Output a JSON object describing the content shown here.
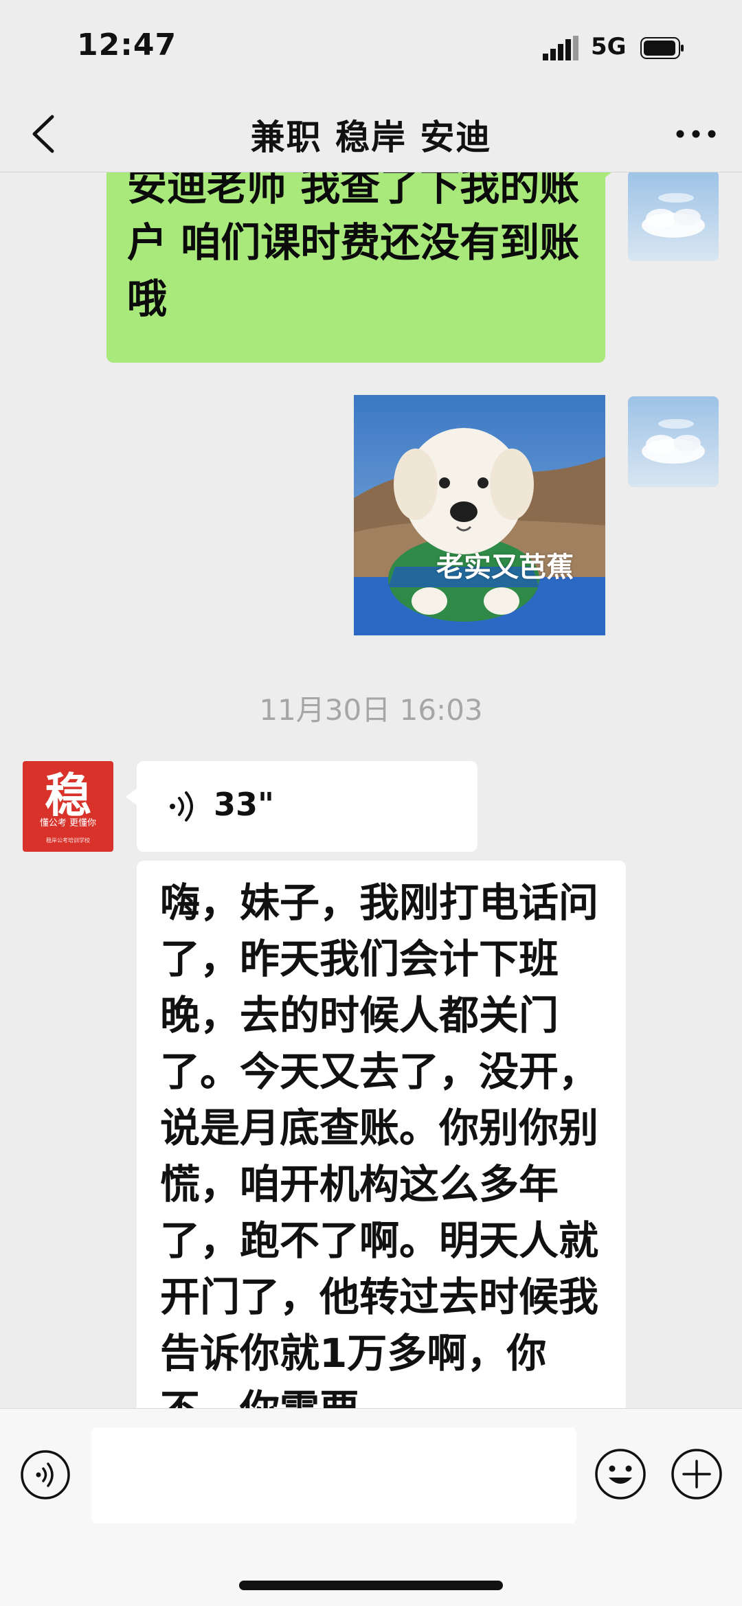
{
  "status_bar": {
    "time": "12:47",
    "network": "5G"
  },
  "nav": {
    "title": "兼职 稳岸 安迪"
  },
  "messages": {
    "outgoing_text": "安迪老师 我查了下我的账户 咱们课时费还没有到账哦",
    "sticker_caption": "老实又芭蕉",
    "timestamp": "11月30日 16:03",
    "voice_duration": "33\"",
    "incoming_text": "嗨，妹子，我刚打电话问了，昨天我们会计下班晚，去的时候人都关门了。今天又去了，没开，说是月底查账。你别你别慌，咱开机构这么多年了，跑不了啊。明天人就开门了，他转过去时候我告诉你就1万多啊，你不，你需要"
  },
  "avatar_other": {
    "logo_char": "稳",
    "slogan": "懂公考 更懂你",
    "small_text": "稳岸公考培训学校",
    "color": "#d8322a"
  },
  "colors": {
    "outgoing_bubble": "#a9e97b",
    "incoming_bubble": "#ffffff",
    "background": "#ededed"
  },
  "icons": {
    "back": "chevron-left-icon",
    "more": "more-dots-icon",
    "voice": "voice-wave-icon",
    "emoji": "smiley-icon",
    "plus": "plus-circle-icon"
  }
}
